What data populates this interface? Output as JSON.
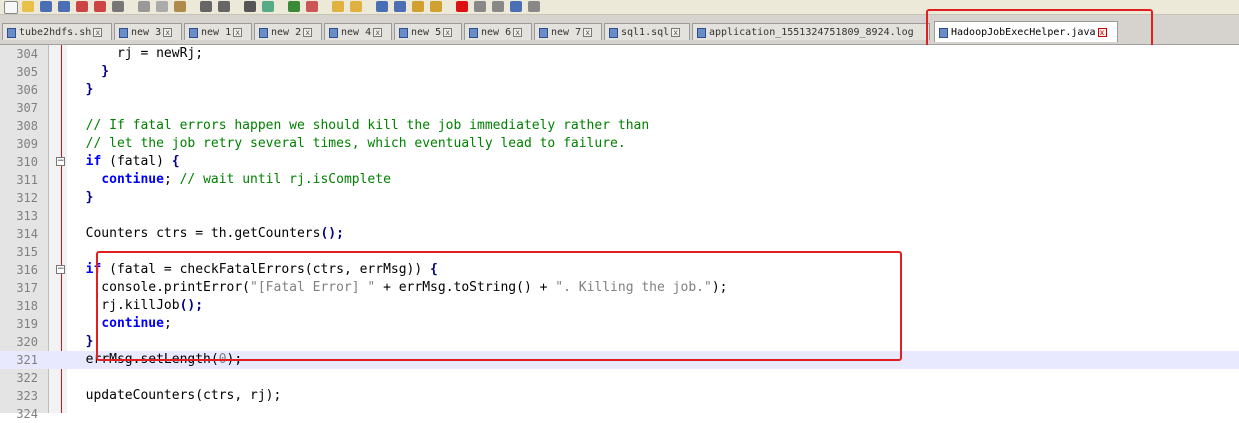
{
  "tabs": [
    {
      "label": "tube2hdfs.sh",
      "active": false
    },
    {
      "label": "new 3",
      "active": false
    },
    {
      "label": "new 1",
      "active": false
    },
    {
      "label": "new 2",
      "active": false
    },
    {
      "label": "new 4",
      "active": false
    },
    {
      "label": "new 5",
      "active": false
    },
    {
      "label": "new 6",
      "active": false
    },
    {
      "label": "new 7",
      "active": false
    },
    {
      "label": "sql1.sql",
      "active": false
    },
    {
      "label": "application_1551324751809_8924.log",
      "active": false
    },
    {
      "label": "HadoopJobExecHelper.java",
      "active": true
    }
  ],
  "lines": [
    {
      "num": "304",
      "current": false,
      "fold": false,
      "parts": [
        {
          "t": "      rj = newRj;",
          "c": ""
        }
      ]
    },
    {
      "num": "305",
      "current": false,
      "fold": false,
      "parts": [
        {
          "t": "    }",
          "c": "op"
        }
      ]
    },
    {
      "num": "306",
      "current": false,
      "fold": false,
      "parts": [
        {
          "t": "  }",
          "c": "op"
        }
      ]
    },
    {
      "num": "307",
      "current": false,
      "fold": false,
      "parts": []
    },
    {
      "num": "308",
      "current": false,
      "fold": false,
      "parts": [
        {
          "t": "  // If fatal errors happen we should kill the job immediately rather than",
          "c": "cm"
        }
      ]
    },
    {
      "num": "309",
      "current": false,
      "fold": false,
      "parts": [
        {
          "t": "  // let the job retry several times, which eventually lead to failure.",
          "c": "cm"
        }
      ]
    },
    {
      "num": "310",
      "current": false,
      "fold": true,
      "parts": [
        {
          "t": "  ",
          "c": ""
        },
        {
          "t": "if",
          "c": "kw"
        },
        {
          "t": " (fatal) ",
          "c": ""
        },
        {
          "t": "{",
          "c": "op"
        }
      ]
    },
    {
      "num": "311",
      "current": false,
      "fold": false,
      "parts": [
        {
          "t": "    ",
          "c": ""
        },
        {
          "t": "continue",
          "c": "kw"
        },
        {
          "t": "; ",
          "c": ""
        },
        {
          "t": "// wait until rj.isComplete",
          "c": "cm"
        }
      ]
    },
    {
      "num": "312",
      "current": false,
      "fold": false,
      "parts": [
        {
          "t": "  }",
          "c": "op"
        }
      ]
    },
    {
      "num": "313",
      "current": false,
      "fold": false,
      "parts": []
    },
    {
      "num": "314",
      "current": false,
      "fold": false,
      "parts": [
        {
          "t": "  Counters ctrs = th.getCounters",
          "c": ""
        },
        {
          "t": "();",
          "c": "op"
        }
      ]
    },
    {
      "num": "315",
      "current": false,
      "fold": false,
      "parts": []
    },
    {
      "num": "316",
      "current": false,
      "fold": true,
      "parts": [
        {
          "t": "  ",
          "c": ""
        },
        {
          "t": "if",
          "c": "kw"
        },
        {
          "t": " (fatal = checkFatalErrors(ctrs, errMsg)) ",
          "c": ""
        },
        {
          "t": "{",
          "c": "op"
        }
      ]
    },
    {
      "num": "317",
      "current": false,
      "fold": false,
      "parts": [
        {
          "t": "    console.printError(",
          "c": ""
        },
        {
          "t": "\"[Fatal Error] \"",
          "c": "str"
        },
        {
          "t": " + errMsg.toString() + ",
          "c": ""
        },
        {
          "t": "\". Killing the job.\"",
          "c": "str"
        },
        {
          "t": ");",
          "c": ""
        }
      ]
    },
    {
      "num": "318",
      "current": false,
      "fold": false,
      "parts": [
        {
          "t": "    rj.killJob",
          "c": ""
        },
        {
          "t": "();",
          "c": "op"
        }
      ]
    },
    {
      "num": "319",
      "current": false,
      "fold": false,
      "parts": [
        {
          "t": "    ",
          "c": ""
        },
        {
          "t": "continue",
          "c": "kw"
        },
        {
          "t": ";",
          "c": ""
        }
      ]
    },
    {
      "num": "320",
      "current": false,
      "fold": false,
      "parts": [
        {
          "t": "  }",
          "c": "op"
        }
      ]
    },
    {
      "num": "321",
      "current": true,
      "fold": false,
      "parts": [
        {
          "t": "  errMsg.setLength(",
          "c": ""
        },
        {
          "t": "0",
          "c": "str"
        },
        {
          "t": ");",
          "c": ""
        }
      ]
    },
    {
      "num": "322",
      "current": false,
      "fold": false,
      "parts": []
    },
    {
      "num": "323",
      "current": false,
      "fold": false,
      "parts": [
        {
          "t": "  updateCounters(ctrs, rj);",
          "c": ""
        }
      ]
    },
    {
      "num": "324",
      "current": false,
      "fold": false,
      "parts": []
    }
  ]
}
